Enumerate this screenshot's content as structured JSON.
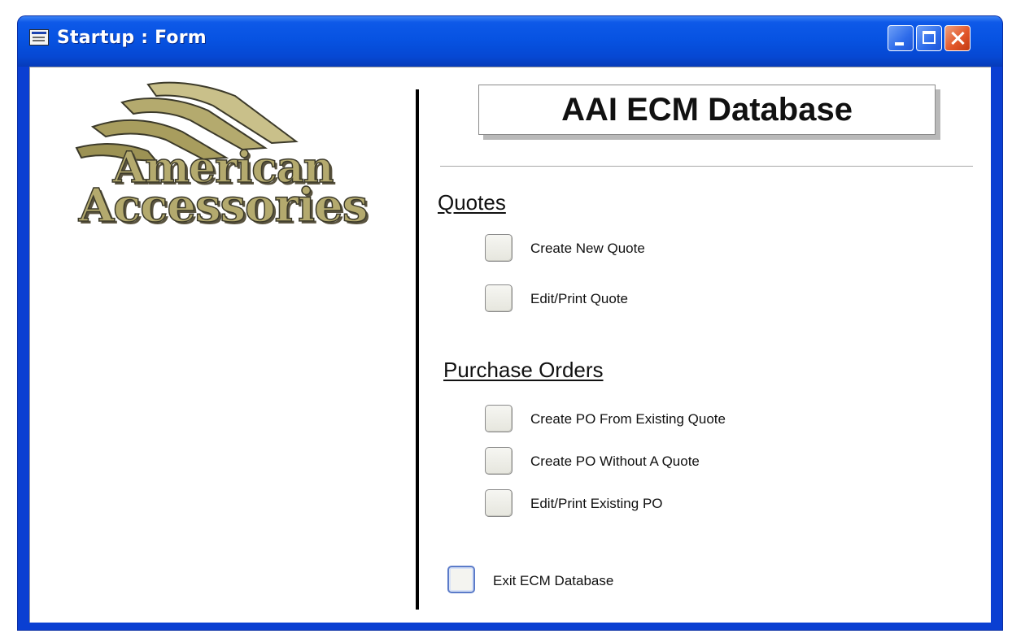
{
  "window": {
    "title": "Startup : Form"
  },
  "logo": {
    "line1": "American",
    "line2": "Accessories"
  },
  "header": {
    "title": "AAI ECM Database"
  },
  "quotes": {
    "heading": "Quotes",
    "buttons": [
      {
        "label": "Create New Quote"
      },
      {
        "label": "Edit/Print Quote"
      }
    ]
  },
  "purchase_orders": {
    "heading": "Purchase Orders",
    "buttons": [
      {
        "label": "Create PO From Existing Quote"
      },
      {
        "label": "Create PO Without A Quote"
      },
      {
        "label": "Edit/Print Existing PO"
      }
    ]
  },
  "exit": {
    "label": "Exit ECM Database"
  },
  "colors": {
    "titlebar": "#0753e2",
    "close_button": "#e2572b",
    "logo_gold": "#b4aa6e"
  }
}
